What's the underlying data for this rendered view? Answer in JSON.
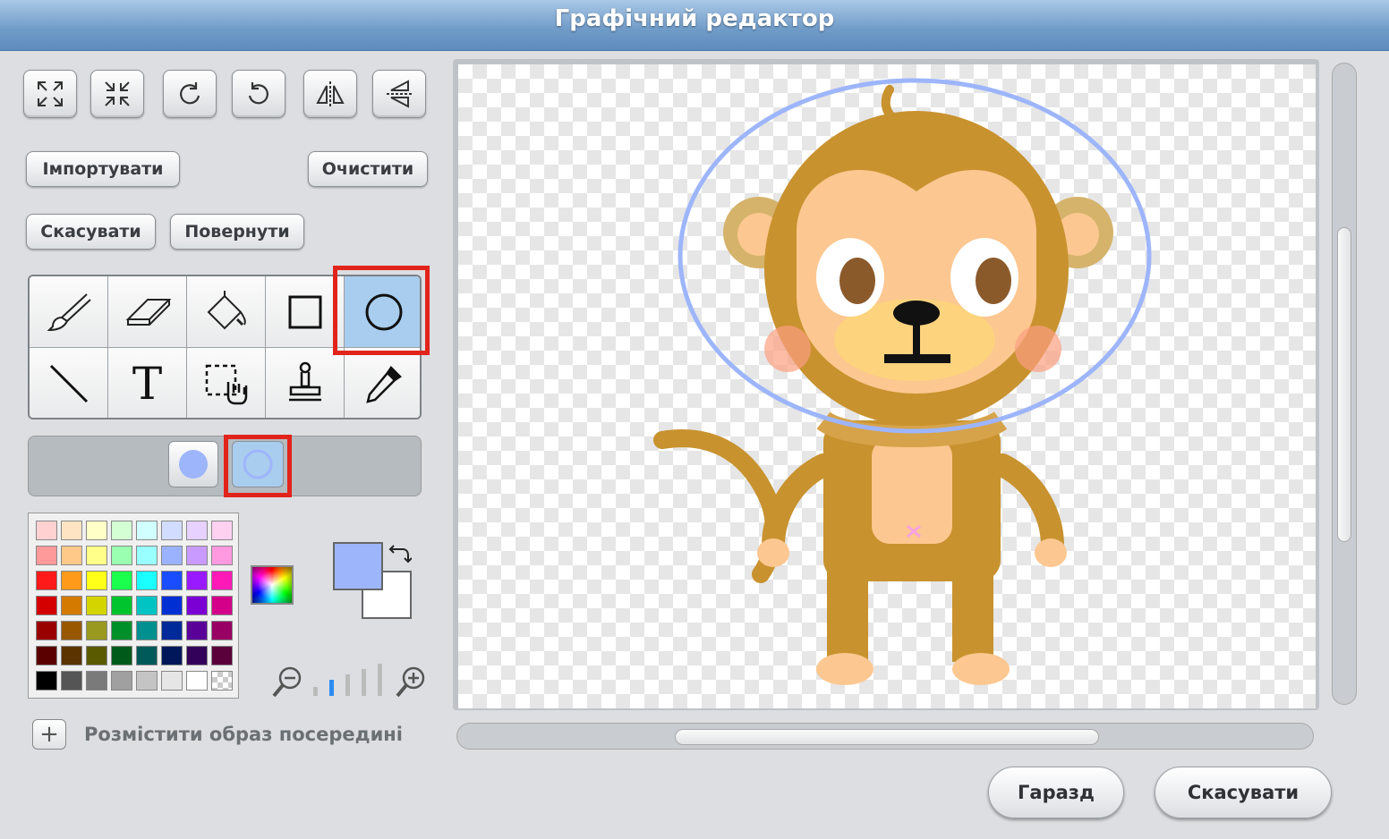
{
  "window": {
    "title": "Графічний редактор"
  },
  "toolbar": {
    "import_label": "Імпортувати",
    "clear_label": "Очистити",
    "undo_label": "Скасувати",
    "redo_label": "Повернути",
    "icon_buttons": [
      "grow-icon",
      "shrink-icon",
      "rotate-left-icon",
      "rotate-right-icon",
      "flip-horizontal-icon",
      "flip-vertical-icon"
    ]
  },
  "tools": {
    "items": [
      "brush-icon",
      "eraser-icon",
      "fill-icon",
      "rectangle-icon",
      "ellipse-icon",
      "line-icon",
      "text-icon",
      "select-icon",
      "stamp-icon",
      "eyedropper-icon"
    ],
    "selected": "ellipse-icon",
    "text_tool_glyph": "T"
  },
  "shape_options": {
    "selected": "outline"
  },
  "colors": {
    "foreground": "#9db5fb",
    "background": "#ffffff",
    "palette": [
      [
        "#ffd1d1",
        "#ffe4c4",
        "#ffffc8",
        "#d4ffd4",
        "#d1ffff",
        "#d1dcff",
        "#e6d1ff",
        "#ffd1f0"
      ],
      [
        "#ff9a9a",
        "#ffc98a",
        "#ffff8a",
        "#9affb0",
        "#9affff",
        "#9ab2ff",
        "#c99aff",
        "#ff9ae0"
      ],
      [
        "#ff1a1a",
        "#ff9a1a",
        "#ffff1a",
        "#1aff4d",
        "#1affff",
        "#1a4dff",
        "#9a1aff",
        "#ff1ab8"
      ],
      [
        "#d40000",
        "#d47a00",
        "#d4d400",
        "#00c42e",
        "#00c4c4",
        "#0030d4",
        "#7a00d4",
        "#d4008a"
      ],
      [
        "#990000",
        "#995800",
        "#99991f",
        "#00902a",
        "#009090",
        "#002a99",
        "#5a0099",
        "#990063"
      ],
      [
        "#5a0000",
        "#5a3300",
        "#5a5a00",
        "#005a1a",
        "#005a5a",
        "#00185a",
        "#33005a",
        "#5a003a"
      ],
      [
        "#000000",
        "#555555",
        "#7a7a7a",
        "#a0a0a0",
        "#c4c4c4",
        "#e6e6e6",
        "#ffffff",
        "checker"
      ]
    ]
  },
  "zoom": {
    "level_index": 1
  },
  "center_image": {
    "label": "Розмістити образ посередині"
  },
  "actions": {
    "ok_label": "Гаразд",
    "cancel_label": "Скасувати"
  }
}
